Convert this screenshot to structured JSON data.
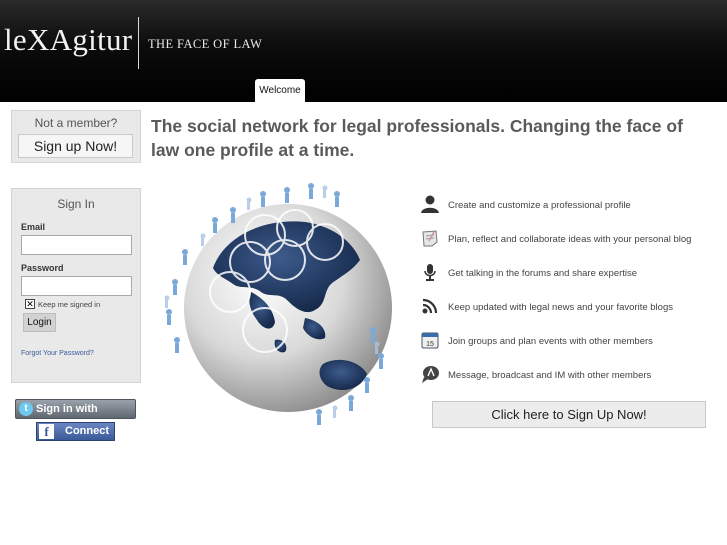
{
  "header": {
    "logo": {
      "part1": "le",
      "part2": "XA",
      "part3": "gitur"
    },
    "tagline": "THE FACE OF LAW",
    "tab_welcome": "Welcome"
  },
  "member_box": {
    "prompt": "Not a member?",
    "signup_label": "Sign up Now!"
  },
  "signin": {
    "title": "Sign In",
    "email_label": "Email",
    "email_value": "",
    "password_label": "Password",
    "password_value": "",
    "keep_signed_in_label": "Keep me signed in",
    "keep_signed_in_checked": true,
    "login_label": "Login",
    "forgot_label": "Forgot Your Password?"
  },
  "social": {
    "twitter_label": "Sign in with Twitter",
    "facebook_label": "Connect"
  },
  "main": {
    "headline": "The social network for legal professionals. Changing the face of law one profile at a time.",
    "features": [
      {
        "icon": "user-profile-icon",
        "text": "Create and customize a professional profile"
      },
      {
        "icon": "notepad-blog-icon",
        "text": "Plan, reflect and collaborate ideas with your personal blog"
      },
      {
        "icon": "microphone-forum-icon",
        "text": "Get talking in the forums and share expertise"
      },
      {
        "icon": "rss-feed-icon",
        "text": "Keep updated with legal news and your favorite blogs"
      },
      {
        "icon": "calendar-icon",
        "text": "Join  groups and plan events with other members"
      },
      {
        "icon": "message-bubble-icon",
        "text": "Message, broadcast and IM with other members"
      }
    ],
    "signup_big_label": "Click here to Sign Up Now!"
  },
  "colors": {
    "header_bg": "#000000",
    "link_blue": "#3a5a9a",
    "facebook_blue": "#3b5998"
  }
}
